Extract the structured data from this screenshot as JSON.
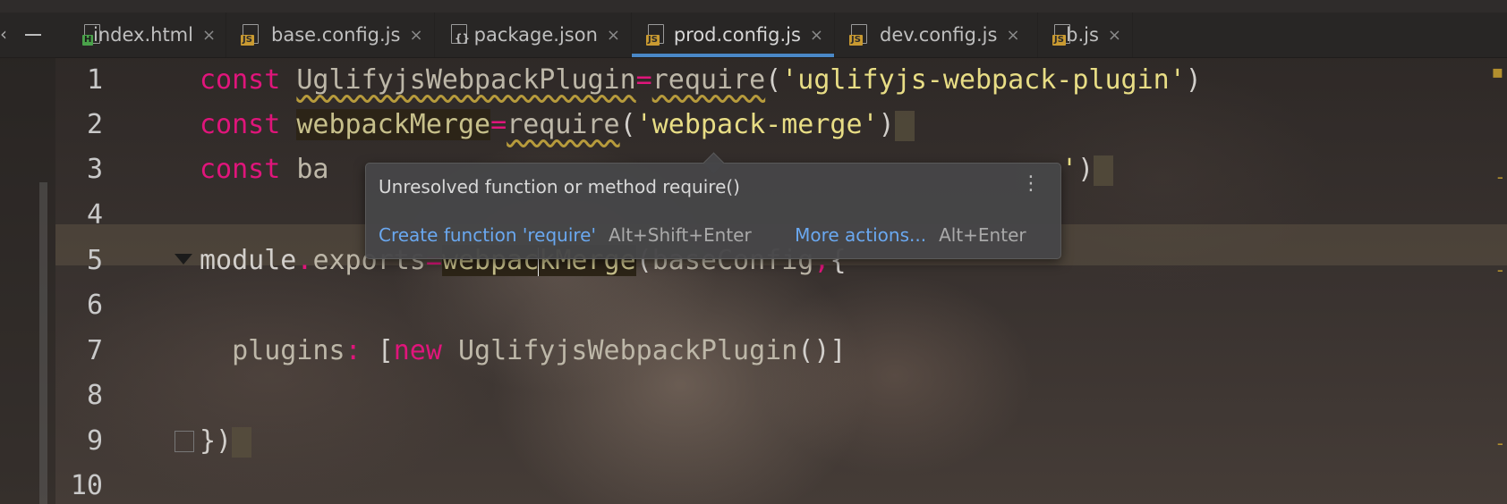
{
  "tabs": [
    {
      "label": "index.html",
      "badge": "H",
      "type": "html",
      "active": false
    },
    {
      "label": "base.config.js",
      "badge": "JS",
      "type": "js",
      "active": false
    },
    {
      "label": "package.json",
      "badge": "{}",
      "type": "json",
      "active": false
    },
    {
      "label": "prod.config.js",
      "badge": "JS",
      "type": "js",
      "active": true
    },
    {
      "label": "dev.config.js",
      "badge": "JS",
      "type": "js",
      "active": false
    },
    {
      "label": "b.js",
      "badge": "JS",
      "type": "js",
      "active": false
    }
  ],
  "editor": {
    "line_numbers": [
      "1",
      "2",
      "3",
      "4",
      "5",
      "6",
      "7",
      "8",
      "9",
      "10"
    ],
    "code": {
      "l1": {
        "kw": "const",
        "name": "UglifyjsWebpackPlugin",
        "eq": "=",
        "fn": "require",
        "open": "(",
        "str": "'uglifyjs-webpack-plugin'",
        "close": ")"
      },
      "l2": {
        "kw": "const",
        "name": "webpackMerge",
        "eq": "=",
        "fn": "require",
        "open": "(",
        "str": "'webpack-merge'",
        "close": ")"
      },
      "l3": {
        "kw": "const",
        "name_visible": "ba",
        "str_tail": "'",
        "close": ")"
      },
      "l5": {
        "obj": "module",
        "dot": ".",
        "prop": "exports",
        "eq": "=",
        "fn_a": "webpac",
        "fn_b": "kMerge",
        "open": "(",
        "arg": "baseConfig",
        "comma": ",",
        "brace": "{"
      },
      "l7": {
        "key": "plugins",
        "colon": ":",
        "open": "[",
        "kw": "new",
        "cls": "UglifyjsWebpackPlugin",
        "call": "()",
        "close": "]"
      },
      "l9": {
        "end": "})"
      }
    }
  },
  "tooltip": {
    "message": "Unresolved function or method require()",
    "menu_icon": "⋮",
    "action1": "Create function 'require'",
    "shortcut1": "Alt+Shift+Enter",
    "action2": "More actions...",
    "shortcut2": "Alt+Enter"
  },
  "icons": {
    "close": "×"
  }
}
